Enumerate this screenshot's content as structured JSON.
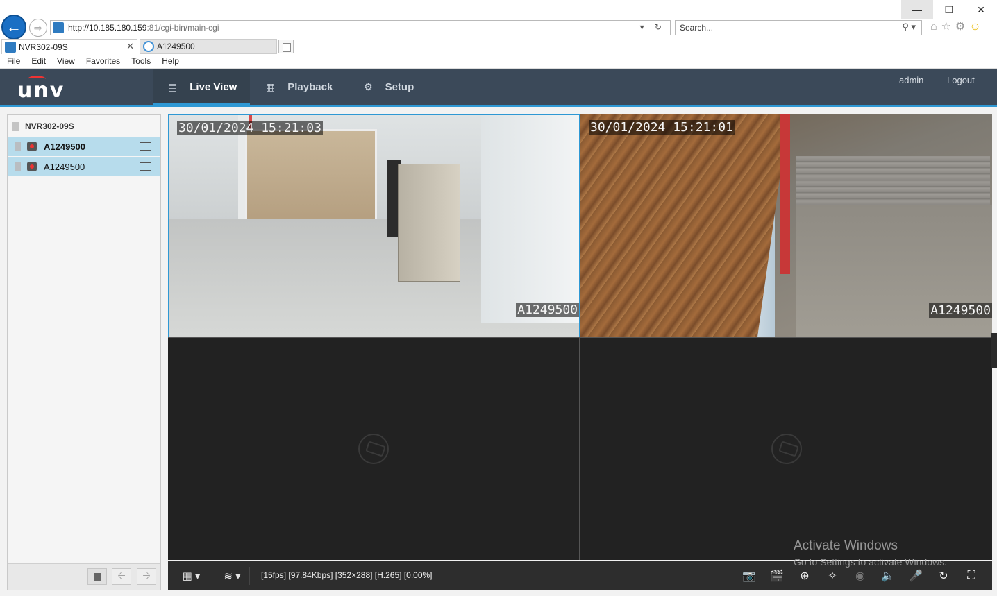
{
  "browser": {
    "url_host": "http://10.185.180.159",
    "url_rest": ":81/cgi-bin/main-cgi",
    "search_placeholder": "Search...",
    "tabs": [
      {
        "label": "NVR302-09S"
      },
      {
        "label": "A1249500"
      }
    ],
    "menu": [
      "File",
      "Edit",
      "View",
      "Favorites",
      "Tools",
      "Help"
    ]
  },
  "app": {
    "logo": "unv",
    "nav": {
      "live_view": "Live View",
      "playback": "Playback",
      "setup": "Setup"
    },
    "user": "admin",
    "logout": "Logout",
    "accent_color": "#2e98d4",
    "header_color": "#3b4959"
  },
  "device_tree": {
    "root": "NVR302-09S",
    "cameras": [
      {
        "name": "A1249500",
        "selected": true
      },
      {
        "name": "A1249500",
        "selected": false
      }
    ]
  },
  "video": {
    "panes": [
      {
        "timestamp": "30/01/2024 15:21:03",
        "camera_name": "A1249500",
        "active": true
      },
      {
        "timestamp": "30/01/2024 15:21:01",
        "camera_name": "A1249500",
        "active": false
      },
      {
        "timestamp": "",
        "camera_name": "",
        "no_signal": true
      },
      {
        "timestamp": "",
        "camera_name": "",
        "no_signal": true
      }
    ]
  },
  "status": {
    "stream_info": "[15fps] [97.84Kbps] [352×288] [H.265] [0.00%]"
  },
  "watermark": {
    "title": "Activate Windows",
    "subtitle": "Go to Settings to activate Windows."
  }
}
